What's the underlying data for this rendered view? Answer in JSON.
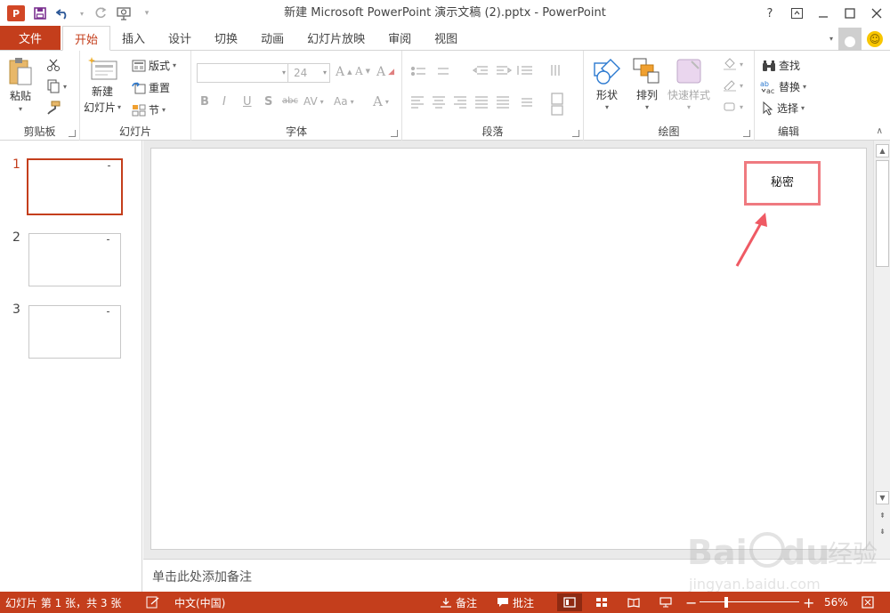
{
  "app": {
    "title": "新建 Microsoft PowerPoint 演示文稿 (2).pptx - PowerPoint",
    "logo_text": "P"
  },
  "window_controls": {
    "help": "?",
    "ribbon_display": "▣",
    "minimize": "—",
    "maximize": "□",
    "close": "✕"
  },
  "tabs": {
    "file": "文件",
    "items": [
      "开始",
      "插入",
      "设计",
      "切换",
      "动画",
      "幻灯片放映",
      "审阅",
      "视图"
    ],
    "active": "开始"
  },
  "ribbon": {
    "clipboard": {
      "label": "剪贴板",
      "paste": "粘贴"
    },
    "slides": {
      "label": "幻灯片",
      "new_slide_line1": "新建",
      "new_slide_line2": "幻灯片",
      "layout": "版式",
      "reset": "重置",
      "section": "节"
    },
    "font": {
      "label": "字体",
      "font_name": "",
      "font_size": "24",
      "grow": "A",
      "shrink": "A",
      "clear": "A",
      "bold": "B",
      "italic": "I",
      "underline": "U",
      "strike": "S",
      "shadow": "abc",
      "spacing": "AV",
      "case": "Aa",
      "color": "A"
    },
    "paragraph": {
      "label": "段落"
    },
    "drawing": {
      "label": "绘图",
      "shapes": "形状",
      "arrange": "排列",
      "quick_styles": "快速样式"
    },
    "editing": {
      "label": "编辑",
      "find": "查找",
      "replace": "替换",
      "select": "选择"
    }
  },
  "thumbnails": [
    {
      "number": "1",
      "selected": true
    },
    {
      "number": "2",
      "selected": false
    },
    {
      "number": "3",
      "selected": false
    }
  ],
  "slide": {
    "textbox_text": "秘密",
    "annotation_color": "#ef5a64"
  },
  "notes": {
    "placeholder": "单击此处添加备注"
  },
  "status": {
    "slide_info": "幻灯片 第 1 张，共 3 张",
    "language": "中文(中国)",
    "notes": "备注",
    "comments": "批注",
    "zoom": "56%"
  },
  "watermark": {
    "brand": "Bai du 经验",
    "url": "jingyan.baidu.com"
  },
  "colors": {
    "accent": "#c43e1c",
    "annotation": "#ef7a80"
  }
}
